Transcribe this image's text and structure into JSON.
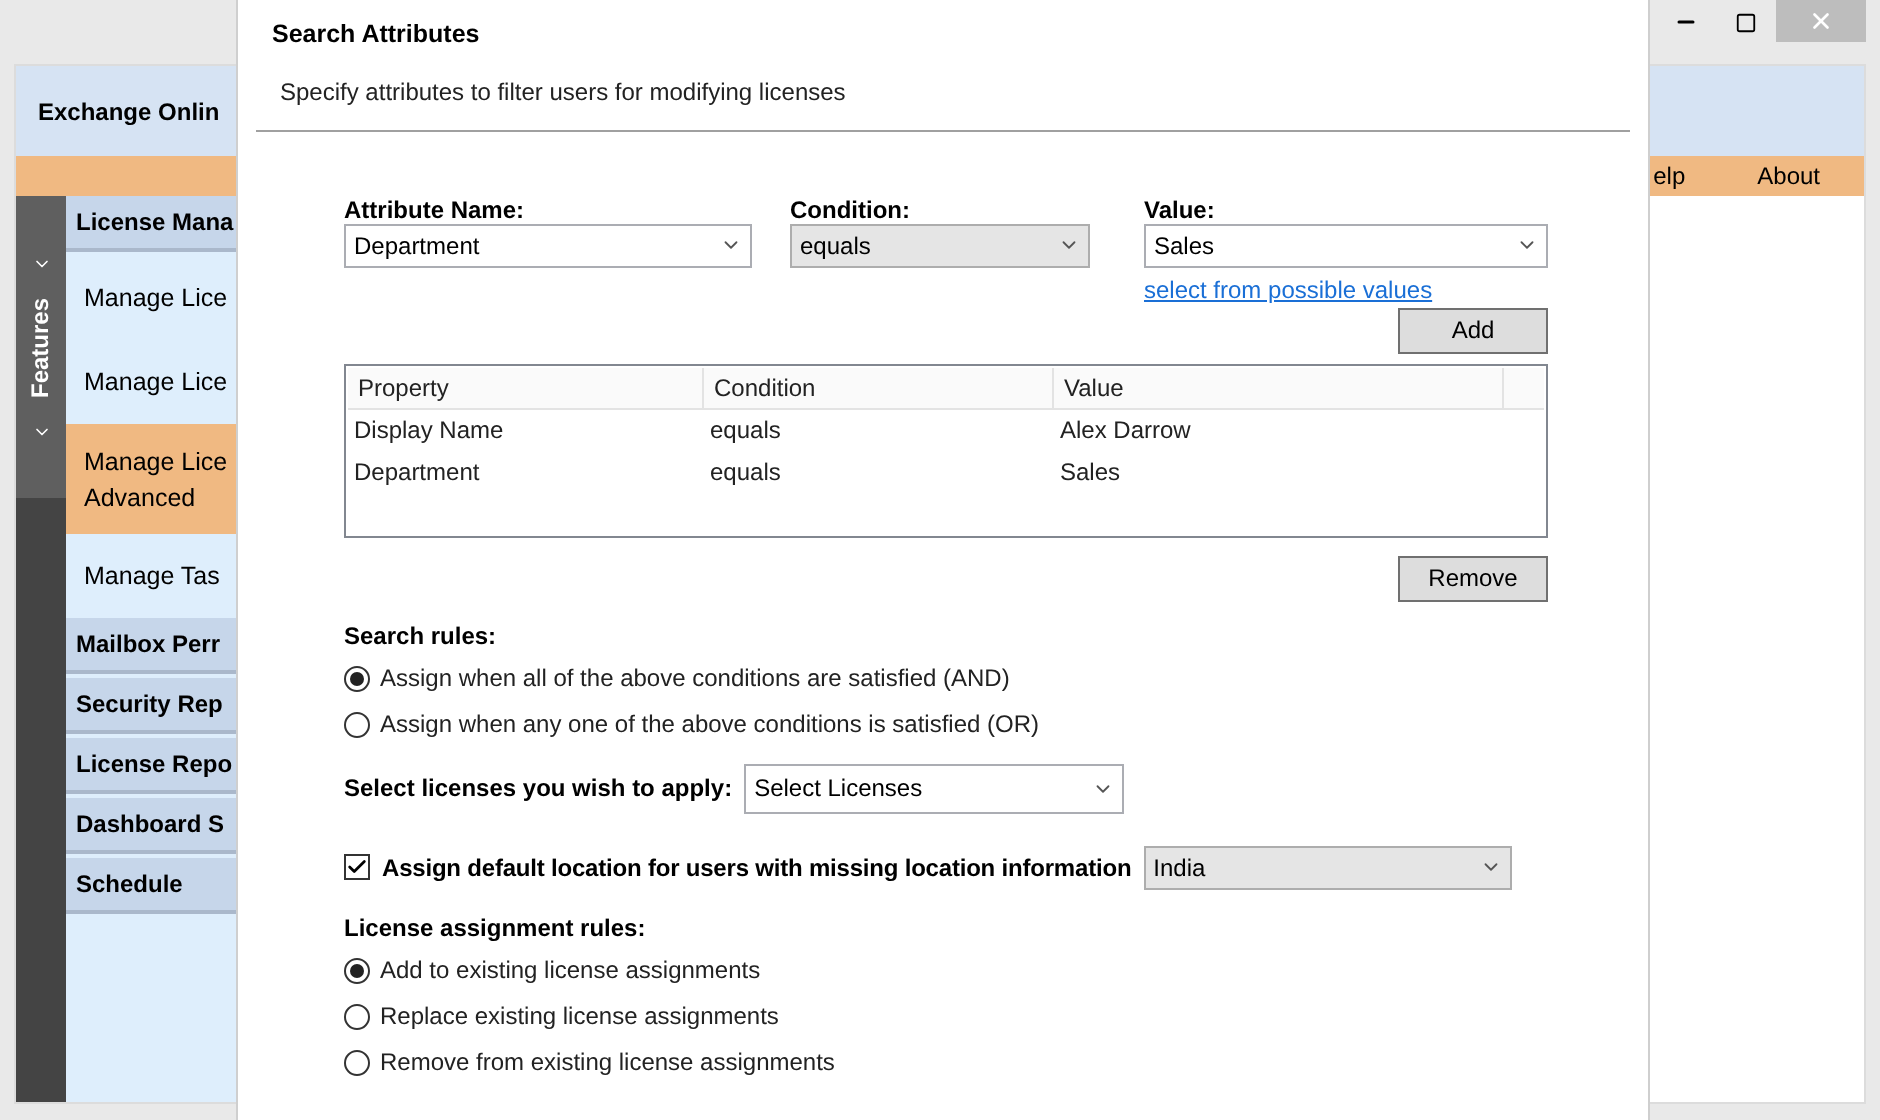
{
  "app": {
    "title": "Exchange Onlin",
    "menu": [
      {
        "label": "elp"
      },
      {
        "label": "About"
      }
    ],
    "side_tab": {
      "label": "Features"
    },
    "nav": [
      {
        "label": "License Mana",
        "children": [
          {
            "label": "Manage Lice",
            "selected": false
          },
          {
            "label": "Manage Lice",
            "selected": false
          },
          {
            "label": "Manage Lice Advanced",
            "selected": true
          },
          {
            "label": "Manage Tas",
            "selected": false
          }
        ]
      },
      {
        "label": "Mailbox Perr"
      },
      {
        "label": "Security Rep"
      },
      {
        "label": "License Repo"
      },
      {
        "label": "Dashboard S"
      },
      {
        "label": "Schedule"
      }
    ]
  },
  "dialog": {
    "title": "Search Attributes",
    "subtitle": "Specify attributes to filter users for modifying licenses",
    "fields": [
      {
        "label": "Attribute Name:",
        "value": "Department",
        "kind": "combo"
      },
      {
        "label": "Condition:",
        "value": "equals",
        "kind": "dropdown"
      },
      {
        "label": "Value:",
        "value": "Sales",
        "kind": "combo",
        "link": "select from possible values"
      }
    ],
    "add_button": "Add",
    "table": {
      "columns": [
        "Property",
        "Condition",
        "Value"
      ],
      "rows": [
        [
          "Display Name",
          "equals",
          "Alex Darrow"
        ],
        [
          "Department",
          "equals",
          "Sales"
        ]
      ]
    },
    "remove_button": "Remove",
    "search_rules": {
      "label": "Search rules:",
      "options": [
        {
          "label": "Assign when all of the above conditions are satisfied (AND)",
          "selected": true
        },
        {
          "label": "Assign when any one of the above conditions is satisfied (OR)",
          "selected": false
        }
      ]
    },
    "licenses": {
      "label": "Select licenses you wish to apply:",
      "value": "Select Licenses",
      "kind": "combo"
    },
    "default_location": {
      "label": "Assign default location for users with missing location information",
      "checked": true,
      "value": "India",
      "kind": "dropdown"
    },
    "assignment_rules": {
      "label": "License assignment rules:",
      "options": [
        {
          "label": "Add to existing license assignments",
          "selected": true
        },
        {
          "label": "Replace existing license assignments",
          "selected": false
        },
        {
          "label": "Remove from existing license assignments",
          "selected": false
        }
      ]
    }
  }
}
